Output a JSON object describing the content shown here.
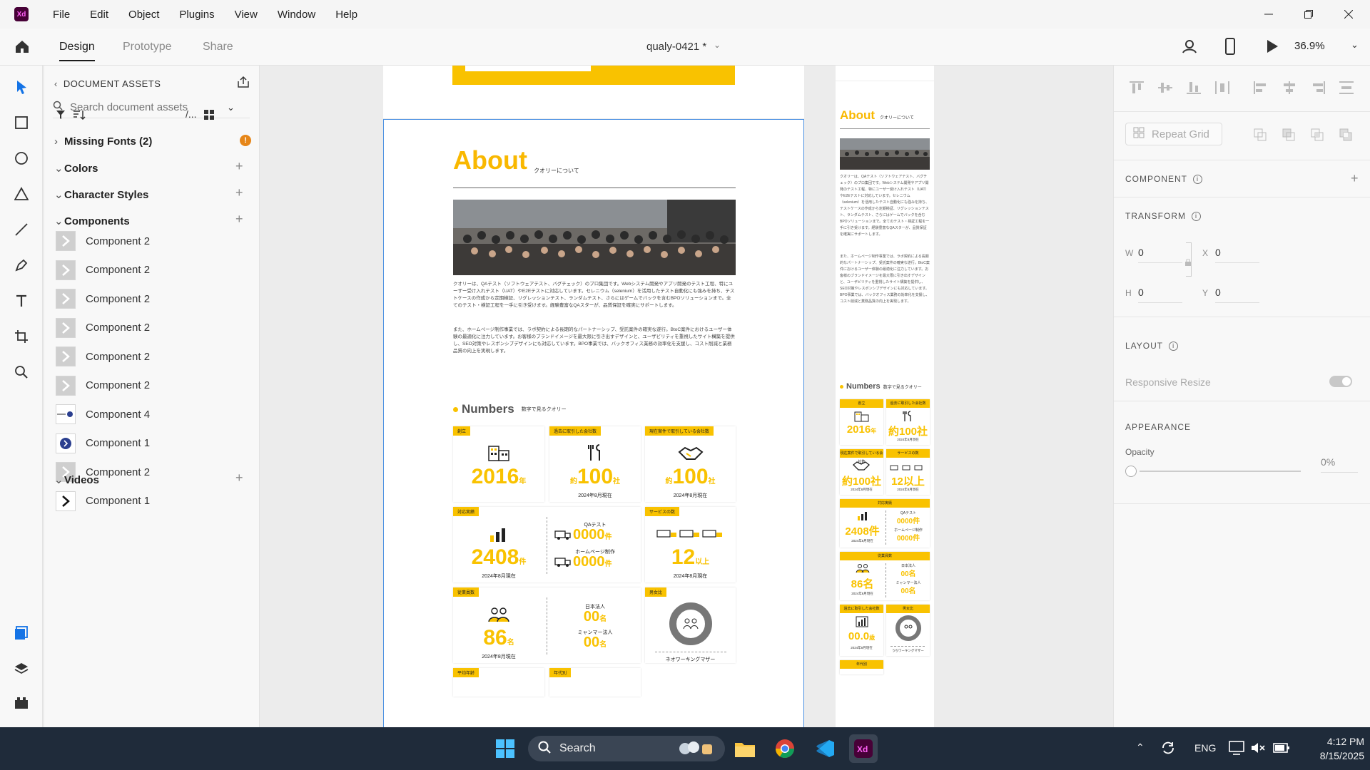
{
  "app": {
    "logo_text": "Xd",
    "menu": [
      "File",
      "Edit",
      "Object",
      "Plugins",
      "View",
      "Window",
      "Help"
    ]
  },
  "toolbar": {
    "tabs": [
      "Design",
      "Prototype",
      "Share"
    ],
    "active_tab": "Design",
    "doc_title": "qualy-0421 *",
    "zoom": "36.9%"
  },
  "assets": {
    "header": "DOCUMENT ASSETS",
    "search_placeholder": "Search document assets",
    "view_toggle": "/...",
    "missing_fonts": "Missing Fonts (2)",
    "sections": {
      "colors": "Colors",
      "character_styles": "Character Styles",
      "components": "Components",
      "videos": "Videos"
    },
    "components": [
      {
        "label": "Component 2",
        "thumb": "chevron-right-gray"
      },
      {
        "label": "Component 2",
        "thumb": "chevron-right-gray"
      },
      {
        "label": "Component 2",
        "thumb": "chevron-right-gray"
      },
      {
        "label": "Component 2",
        "thumb": "chevron-right-gray"
      },
      {
        "label": "Component 2",
        "thumb": "chevron-right-gray"
      },
      {
        "label": "Component 2",
        "thumb": "chevron-right-gray"
      },
      {
        "label": "Component 4",
        "thumb": "slider-dot"
      },
      {
        "label": "Component 1",
        "thumb": "blue-circle-chevron"
      },
      {
        "label": "Component 2",
        "thumb": "chevron-right-gray"
      },
      {
        "label": "Component 1",
        "thumb": "chevron-right-black"
      }
    ]
  },
  "artboard": {
    "about_title": "About",
    "about_sub": "クオリーについて",
    "para1": "クオリーは、QAテスト（ソフトウェアテスト、バグチェック）のプロ集団です。Webシステム開発やアプリ開発のテスト工程、特にユーザー受け入れテスト（UAT）やE2Eテストに対応しています。セレニウム（selenium）を活用したテスト自動化にも強みを持ち、テストケースの作成から定期検証、リグレッションテスト、ランダムテスト、さらにはゲームでバックを含むBPOソリューションまで。全てのテスト・検証工程を一手に引き受けます。経験豊富なQAスターが、品質保証を確実にサポートします。",
    "para2": "また、ホームページ制作事業では、ラボ契約による長期的なパートナーシップ、受託案件の確実な遂行。BtoC案件におけるユーザー体験の最適化に注力しています。お客様のブランドイメージを最大限に引き出すデザインと、ユーザビリティを重視したサイト構築を提供し、SEO対策やレスポンシブデザインにも対応しています。BPO事業では、バックオフィス業務の効率化を支援し、コスト削減と業務品質の向上を実現します。",
    "numbers_title": "Numbers",
    "numbers_sub": "数字で見るクオリー",
    "cards": {
      "founded": {
        "tag": "創立",
        "value": "2016",
        "unit": "年"
      },
      "past_clients": {
        "tag": "過去に取引した会社数",
        "prefix": "約",
        "value": "100",
        "unit": "社",
        "note": "2024年8月現在"
      },
      "current_clients": {
        "tag": "現在案件で取引している会社数",
        "prefix": "約",
        "value": "100",
        "unit": "社",
        "note": "2024年8月現在"
      },
      "results": {
        "tag": "対応実績",
        "value": "2408",
        "unit": "件",
        "note": "2024年8月現在"
      },
      "qa": {
        "label": "QAテスト",
        "value": "0000",
        "unit": "件"
      },
      "hp": {
        "label": "ホームページ制作",
        "value": "0000",
        "unit": "件"
      },
      "services": {
        "tag": "サービスの数",
        "value": "12",
        "unit": "以上",
        "note": "2024年8月現在"
      },
      "employees": {
        "tag": "従業員数",
        "value": "86",
        "unit": "名",
        "note": "2024年8月現在"
      },
      "japan": {
        "label": "日本法人",
        "value": "00",
        "unit": "名"
      },
      "myanmar": {
        "label": "ミャンマー法人",
        "value": "00",
        "unit": "名"
      },
      "gender": {
        "tag": "男女比",
        "caption": "ネオワーキングマザー"
      },
      "avg_age": {
        "tag": "平均年齢"
      },
      "age_group": {
        "tag": "年代別"
      }
    }
  },
  "artboard2": {
    "about_title": "About",
    "about_sub": "クオリーについて",
    "para1": "クオリーは、QAテスト（ソフトウェアテスト、バグチェック）のプロ集団です。Webシステム開発やアプリ開発のテスト工程、特にユーザー受け入れテスト（UAT）やE2Eテストに対応しています。セレニウム（selenium）を活用したテスト自動化にも強みを持ち、テストケースの作成から定期検証、リグレッションテスト、ランダムテスト、さらにはゲームでバックを含むBPOソリューションまで。全てのテスト・検証工程を一手に引き受けます。経験豊富なQAスターが、品質保証を確実にサポートします。",
    "para2": "また、ホームページ制作事業では、ラボ契約による長期的なパートナーシップ、受託案件の確実な遂行。BtoC案件におけるユーザー体験の最適化に注力しています。お客様のブランドイメージを最大限に引き出すデザインと、ユーザビリティを重視したサイト構築を提供し、SEO対策やレスポンシブデザインにも対応しています。BPO事業では、バックオフィス業務の効率化を支援し、コスト削減と業務品質の向上を実現します。",
    "numbers_title": "Numbers",
    "numbers_sub": "数字で見るクオリー",
    "m_founded": {
      "tag": "創立",
      "value": "2016",
      "unit": "年"
    },
    "m_past": {
      "tag": "過去に取引した会社数",
      "value": "約100社",
      "note": "2024年8月現在"
    },
    "m_current": {
      "tag": "現在案件で取引している会社数",
      "value": "約100社",
      "note": "2024年8月現在"
    },
    "m_services": {
      "tag": "サービスの数",
      "value": "12以上",
      "note": "2024年8月現在"
    },
    "m_results": {
      "tag": "対応実績",
      "value": "2408件",
      "note": "2024年8月現在",
      "qa_label": "QAテスト",
      "qa_value": "0000件",
      "hp_label": "ホームページ制作",
      "hp_value": "0000件"
    },
    "m_employees": {
      "tag": "従業員数",
      "value": "86名",
      "note": "2024年8月現在",
      "japan_label": "日本法人",
      "japan_value": "00名",
      "myanmar_label": "ミャンマー法人",
      "myanmar_value": "00名"
    },
    "m_past2": {
      "tag": "過去に取引した会社数",
      "value": "00.0",
      "unit": "歳",
      "note": "2024年8月現在"
    },
    "m_gender": {
      "tag": "男女比",
      "caption": "うちワーキングマザー"
    },
    "m_age": {
      "tag": "年代別"
    }
  },
  "props": {
    "repeat_grid": "Repeat Grid",
    "component": "COMPONENT",
    "transform": "TRANSFORM",
    "w_label": "W",
    "w_value": "0",
    "x_label": "X",
    "x_value": "0",
    "h_label": "H",
    "h_value": "0",
    "y_label": "Y",
    "y_value": "0",
    "layout": "LAYOUT",
    "responsive_resize": "Responsive Resize",
    "appearance": "APPEARANCE",
    "opacity_label": "Opacity",
    "opacity_value": "0%"
  },
  "taskbar": {
    "search": "Search",
    "lang": "ENG",
    "time": "4:12 PM",
    "date": "8/15/2025"
  },
  "colors": {
    "accent_yellow": "#f9c200",
    "selection_blue": "#4a90e2",
    "xd_purple": "#470137"
  }
}
